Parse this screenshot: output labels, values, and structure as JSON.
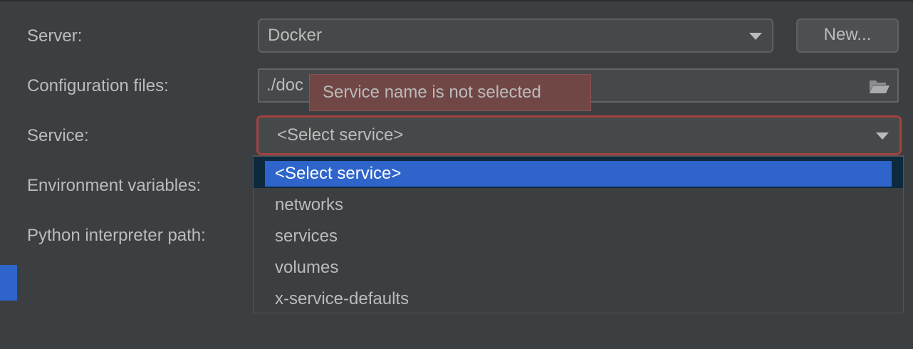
{
  "form": {
    "server_label": "Server:",
    "server_value": "Docker",
    "new_button_label": "New...",
    "config_files_label": "Configuration files:",
    "config_files_value": "./doc",
    "service_label": "Service:",
    "service_value": "<Select service>",
    "env_vars_label": "Environment variables:",
    "python_path_label": "Python interpreter path:"
  },
  "tooltip": {
    "text": "Service name is not selected"
  },
  "service_dropdown": {
    "items": [
      {
        "label": "<Select service>",
        "selected": true
      },
      {
        "label": "networks"
      },
      {
        "label": "services"
      },
      {
        "label": "volumes"
      },
      {
        "label": "x-service-defaults"
      }
    ]
  },
  "colors": {
    "background": "#3c3f41",
    "error_border": "#a5403f",
    "tooltip_background": "#704745",
    "selection": "#2f65ca"
  },
  "icons": {
    "server_dropdown": "chevron-down-icon",
    "config_browse": "folder-open-icon",
    "service_dropdown": "chevron-down-icon"
  }
}
